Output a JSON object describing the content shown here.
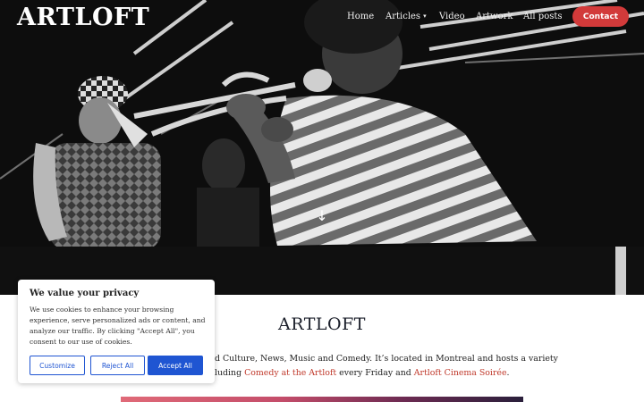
{
  "header": {
    "brand": "ARTLOFT",
    "nav": {
      "home": "Home",
      "articles": "Articles",
      "video": "Video",
      "artwork": "Artwork",
      "all_posts": "All posts"
    },
    "contact": "Contact"
  },
  "hero": {
    "scroll_icon": "arrow-down-icon"
  },
  "main": {
    "title": "ARTLOFT",
    "intro_line1": "d Culture, News, Music and Comedy. It’s located in Montreal and hosts a variety",
    "intro_line2_before": "luding ",
    "link_comedy": "Comedy at the Artloft",
    "intro_line2_middle": " every Friday and ",
    "link_cinema": "Artloft Cinema Soirée",
    "intro_line2_after": "."
  },
  "cookie_banner": {
    "title": "We value your privacy",
    "text": "We use cookies to enhance your browsing experience, serve personalized ads or content, and analyze our traffic. By clicking \"Accept All\", you consent to our use of cookies.",
    "customize": "Customize",
    "reject": "Reject All",
    "accept": "Accept All"
  },
  "colors": {
    "accent": "#d23a3a",
    "link": "#c0392b",
    "cookie_button": "#1f55d2"
  }
}
